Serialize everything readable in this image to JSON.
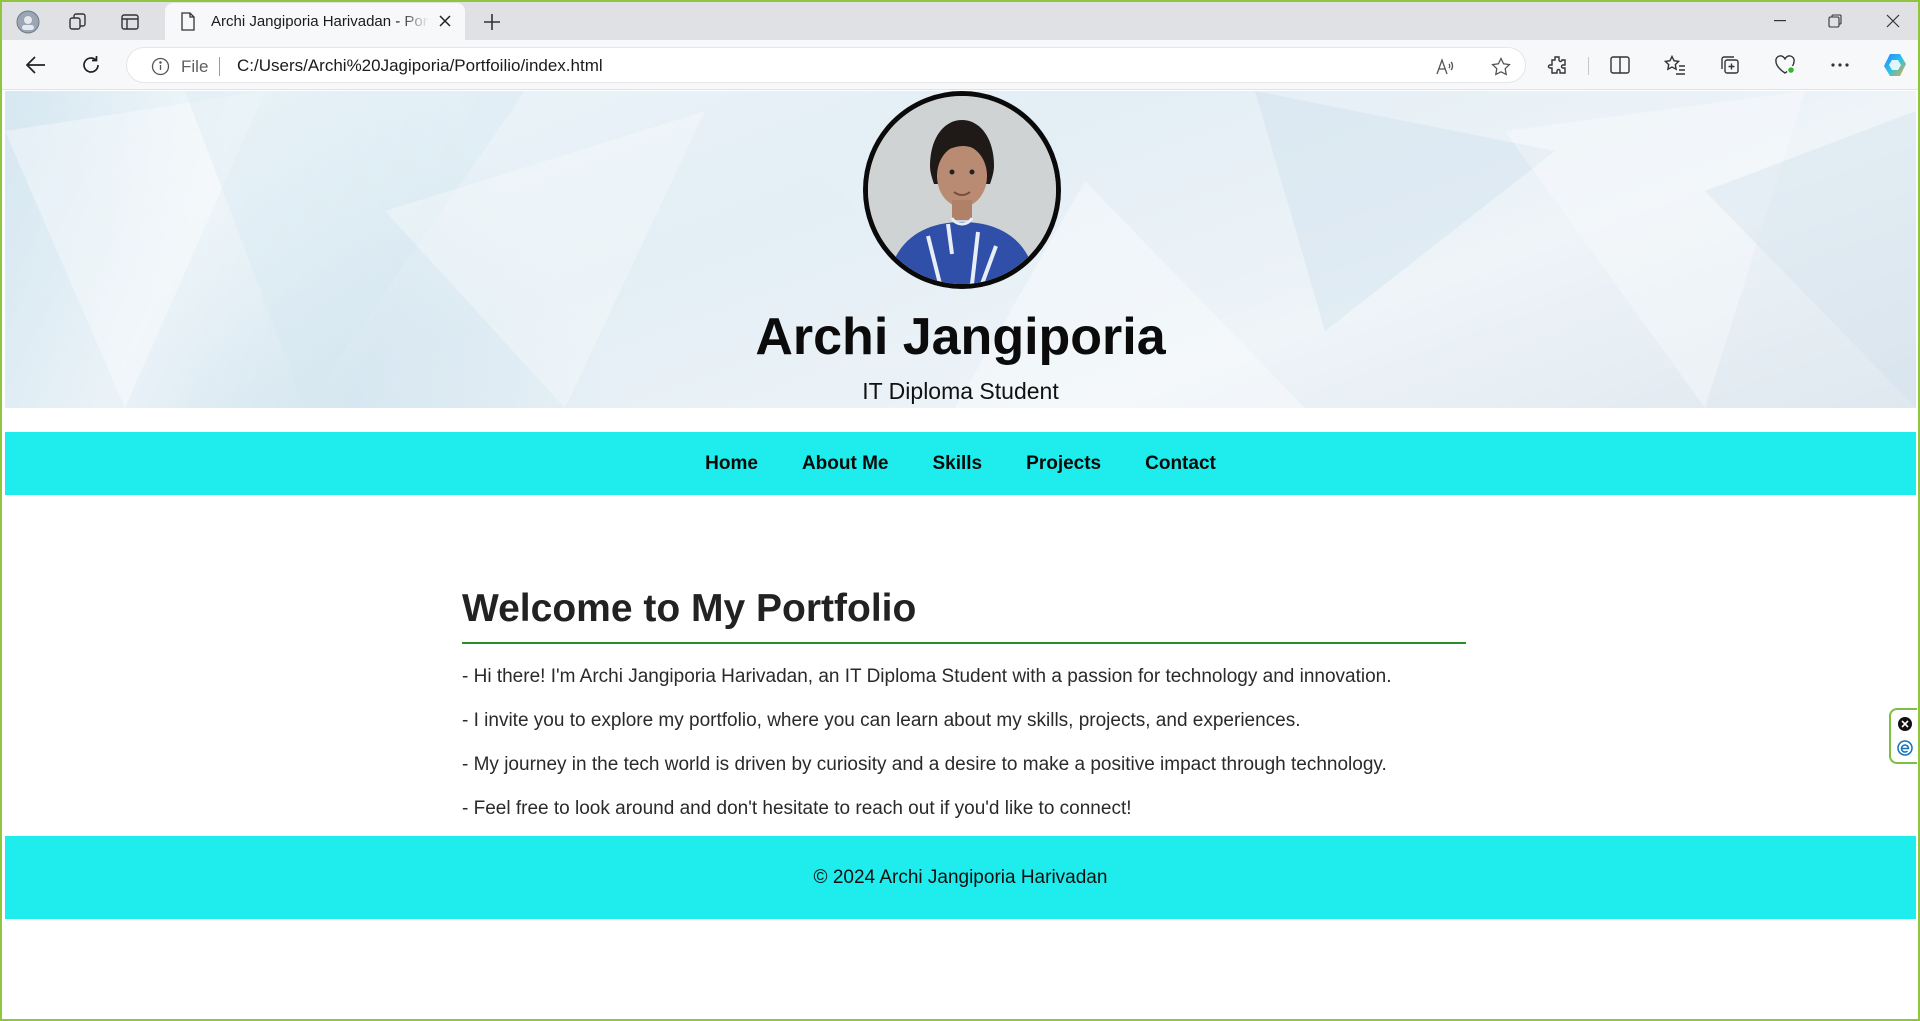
{
  "browser": {
    "tab_title": "Archi Jangiporia Harivadan - Portfolio",
    "address_scheme_label": "File",
    "url": "C:/Users/Archi%20Jagiporia/Portfoilio/index.html"
  },
  "header": {
    "avatar_alt": "Profile photo",
    "name": "Archi Jangiporia",
    "subtitle": "IT Diploma Student"
  },
  "nav": {
    "items": [
      {
        "label": "Home"
      },
      {
        "label": "About Me"
      },
      {
        "label": "Skills"
      },
      {
        "label": "Projects"
      },
      {
        "label": "Contact"
      }
    ]
  },
  "main": {
    "heading": "Welcome to My Portfolio",
    "paragraphs": [
      "- Hi there! I'm Archi Jangiporia Harivadan, an IT Diploma Student with a passion for technology and innovation.",
      "- I invite you to explore my portfolio, where you can learn about my skills, projects, and experiences.",
      "- My journey in the tech world is driven by curiosity and a desire to make a positive impact through technology.",
      "- Feel free to look around and don't hesitate to reach out if you'd like to connect!"
    ]
  },
  "footer": {
    "text": "© 2024 Archi Jangiporia Harivadan"
  },
  "colors": {
    "nav_bg": "#1fecec",
    "footer_bg": "#1fecec",
    "heading_underline": "#2a8c2a",
    "window_border": "#8fc640"
  }
}
